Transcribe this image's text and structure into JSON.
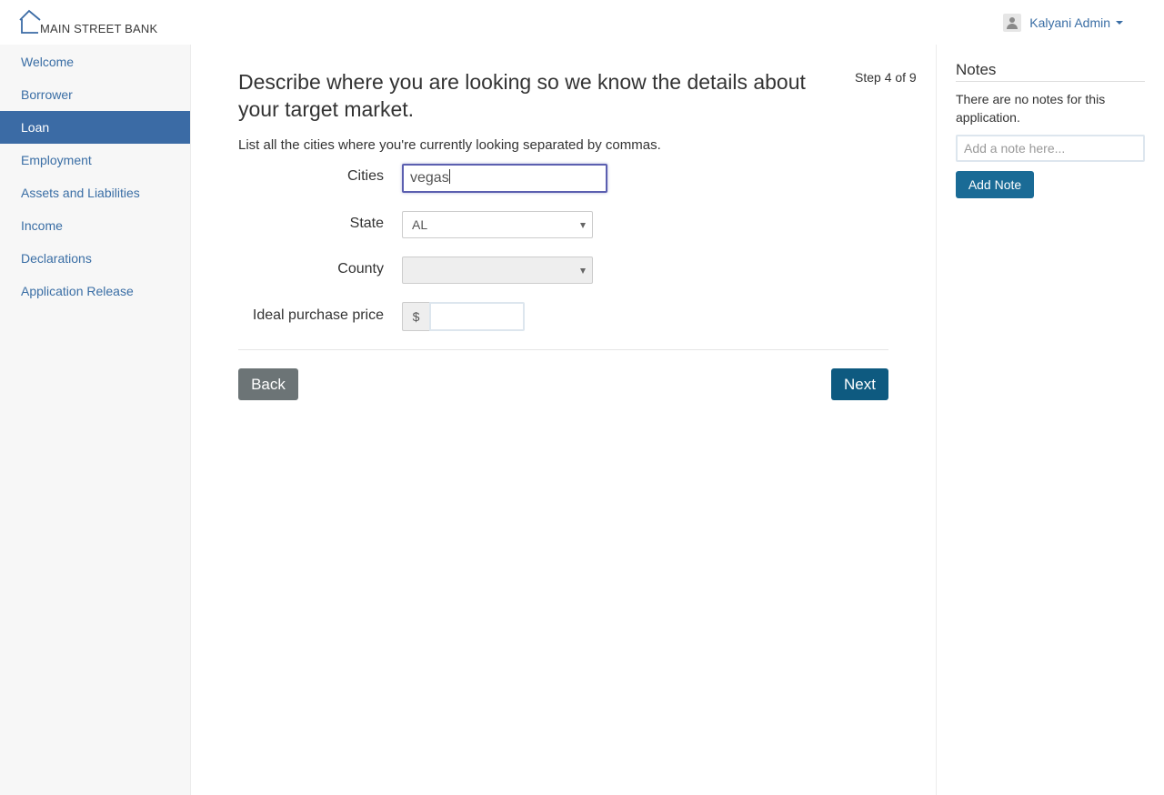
{
  "header": {
    "brand": "MAIN STREET BANK",
    "user_name": "Kalyani Admin"
  },
  "sidebar": {
    "items": [
      {
        "label": "Welcome"
      },
      {
        "label": "Borrower"
      },
      {
        "label": "Loan",
        "active": true
      },
      {
        "label": "Employment"
      },
      {
        "label": "Assets and Liabilities"
      },
      {
        "label": "Income"
      },
      {
        "label": "Declarations"
      },
      {
        "label": "Application Release"
      }
    ]
  },
  "main": {
    "title": "Describe where you are looking so we know the details about your target market.",
    "step": "Step 4 of 9",
    "instructions": "List all the cities where you're currently looking separated by commas.",
    "cities_label": "Cities",
    "cities_value": "vegas",
    "state_label": "State",
    "state_value": "AL",
    "county_label": "County",
    "county_value": "",
    "price_label": "Ideal purchase price",
    "price_prefix": "$",
    "price_value": "",
    "back_label": "Back",
    "next_label": "Next"
  },
  "notes": {
    "title": "Notes",
    "empty_text": "There are no notes for this application.",
    "input_placeholder": "Add a note here...",
    "add_label": "Add Note"
  },
  "colors": {
    "nav_active": "#3b6ba5",
    "link": "#3a6ea5",
    "next_button": "#0e5a80",
    "back_button": "#6c7476",
    "add_note_button": "#1a6b96"
  }
}
